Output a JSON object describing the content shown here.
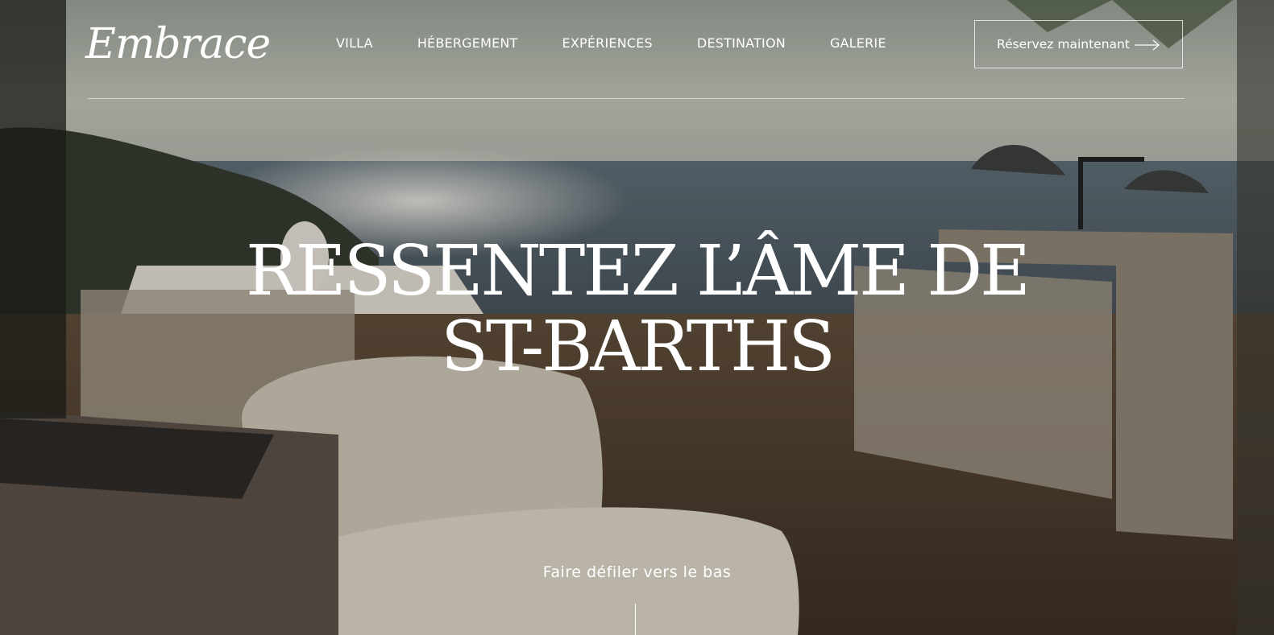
{
  "brand": {
    "logo_text": "Embrace"
  },
  "nav": {
    "items": [
      {
        "label": "VILLA"
      },
      {
        "label": "HÉBERGEMENT"
      },
      {
        "label": "EXPÉRIENCES"
      },
      {
        "label": "DESTINATION"
      },
      {
        "label": "GALERIE"
      }
    ]
  },
  "cta": {
    "label": "Réservez maintenant",
    "icon": "arrow-right-icon"
  },
  "hero": {
    "title_line1": "RESSENTEZ L’ÂME DE",
    "title_line2": "ST-BARTHS",
    "scroll_label": "Faire défiler vers le bas"
  },
  "colors": {
    "text": "#ffffff",
    "overlay": "#2c2a24"
  }
}
